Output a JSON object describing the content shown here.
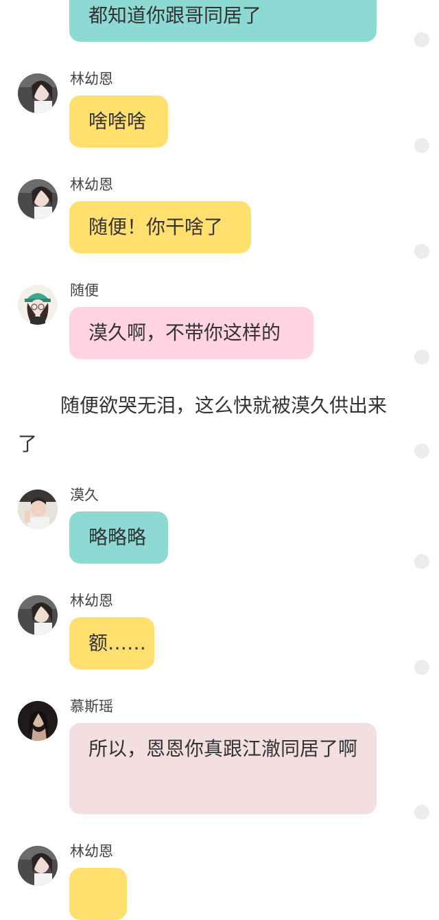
{
  "colors": {
    "teal": "#8cdad3",
    "yellow": "#ffdf6e",
    "pink": "#ffd3df",
    "light_pink": "#f3dfe2",
    "dot": "#ececec"
  },
  "messages": [
    {
      "text": "都知道你跟哥同居了",
      "color": "teal"
    },
    {
      "sender": "林幼恩",
      "avatar": "avatar-girl-icon",
      "text": "啥啥啥",
      "color": "yellow"
    },
    {
      "sender": "林幼恩",
      "avatar": "avatar-girl-icon",
      "text": "随便！你干啥了",
      "color": "yellow"
    },
    {
      "sender": "随便",
      "avatar": "avatar-cap-girl-icon",
      "text": "漠久啊，不带你这样的",
      "color": "pink"
    },
    {
      "sender": "漠久",
      "avatar": "avatar-boy-icon",
      "text": "略略略",
      "color": "teal"
    },
    {
      "sender": "林幼恩",
      "avatar": "avatar-girl-icon",
      "text": "额……",
      "color": "yellow"
    },
    {
      "sender": "慕斯瑶",
      "avatar": "avatar-dark-girl-icon",
      "text": "所以，恩恩你真跟江澈同居了啊",
      "color": "light_pink"
    },
    {
      "sender": "林幼恩",
      "avatar": "avatar-girl-icon",
      "text": "",
      "color": "yellow"
    }
  ],
  "narration": "随便欲哭无泪，这么快就被漠久供出来了"
}
